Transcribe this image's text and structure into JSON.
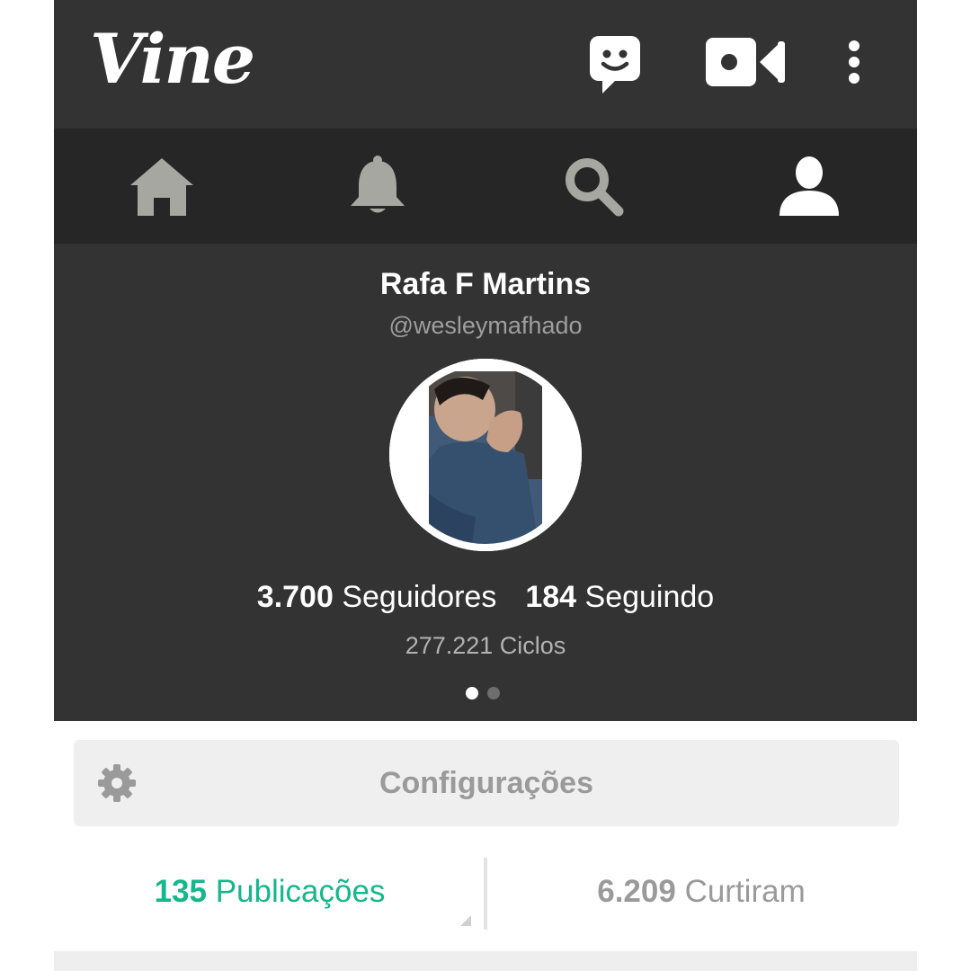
{
  "app": {
    "logo_text": "Vine",
    "colors": {
      "header_bg": "#333333",
      "nav_bg": "#262626",
      "accent": "#17b68c",
      "muted": "#9a9a9a"
    }
  },
  "header": {
    "icons": [
      "chat-smiley-icon",
      "video-camera-icon",
      "more-vert-icon"
    ]
  },
  "nav": {
    "tabs": [
      {
        "icon": "home-icon",
        "active": false
      },
      {
        "icon": "bell-icon",
        "active": false
      },
      {
        "icon": "search-icon",
        "active": false
      },
      {
        "icon": "profile-icon",
        "active": true
      }
    ]
  },
  "profile": {
    "name": "Rafa F Martins",
    "handle": "@wesleymafhado",
    "followers_count": "3.700",
    "followers_label": "Seguidores",
    "following_count": "184",
    "following_label": "Seguindo",
    "loops": "277.221 Ciclos",
    "pager": {
      "pages": 2,
      "current": 1
    }
  },
  "settings": {
    "label": "Configurações",
    "icon": "gear-icon"
  },
  "counters": {
    "posts_count": "135",
    "posts_label": "Publicações",
    "likes_count": "6.209",
    "likes_label": "Curtiram"
  }
}
